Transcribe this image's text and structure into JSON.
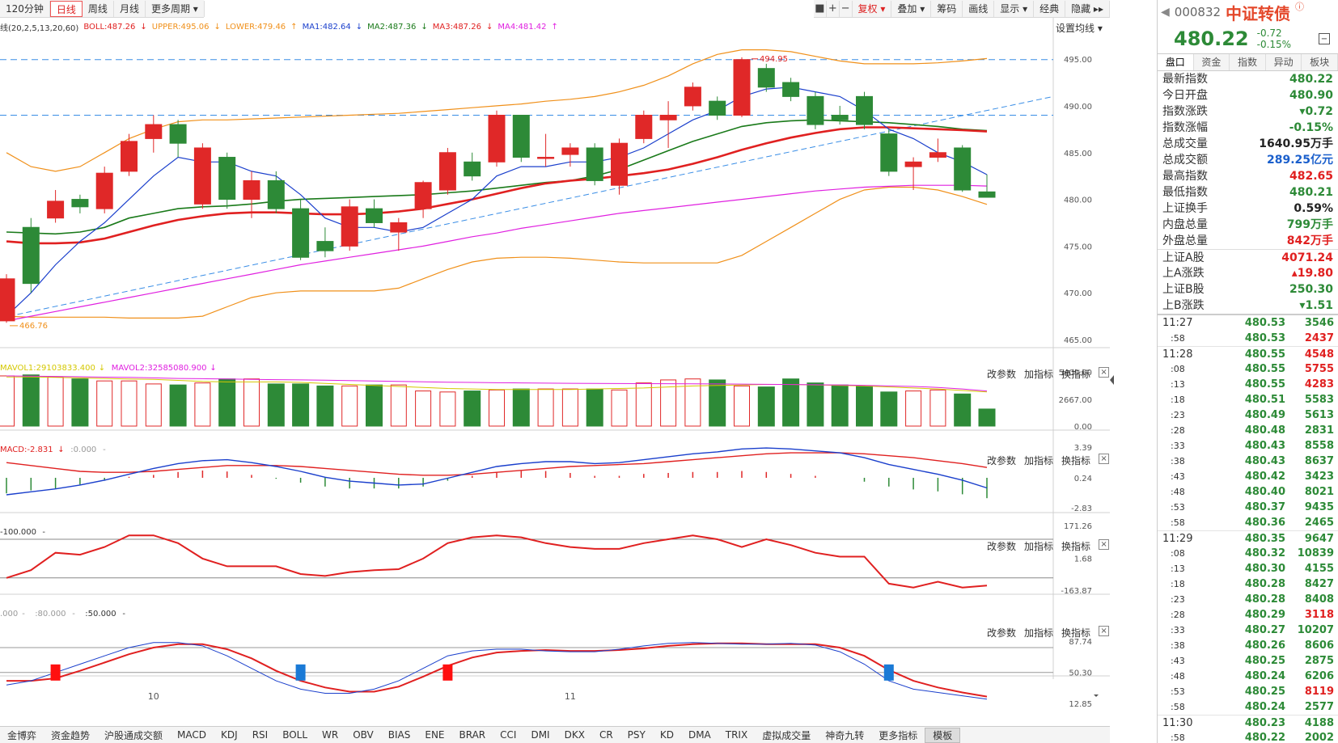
{
  "toolbar": {
    "period_tabs": [
      "120分钟",
      "日线",
      "周线",
      "月线",
      "更多周期 ▾"
    ],
    "active_period": "日线",
    "right_items": [
      "复权 ▾",
      "叠加 ▾",
      "筹码",
      "画线",
      "显示 ▾",
      "经典",
      "隐藏 ▸▸"
    ],
    "icons": [
      "lock-icon",
      "plus-icon",
      "minus-icon"
    ]
  },
  "legend": {
    "prefix": "线(20,2,5,13,20,60)",
    "items": [
      {
        "text": "BOLL:487.26",
        "color": "#e02020",
        "arrow": "↓"
      },
      {
        "text": "UPPER:495.06",
        "color": "#f0901a",
        "arrow": "↓"
      },
      {
        "text": "LOWER:479.46",
        "color": "#f0901a",
        "arrow": "↑"
      },
      {
        "text": "MA1:482.64",
        "color": "#1a3fcc",
        "arrow": "↓"
      },
      {
        "text": "MA2:487.36",
        "color": "#1a7a1a",
        "arrow": "↓"
      },
      {
        "text": "MA3:487.26",
        "color": "#e02020",
        "arrow": "↓"
      },
      {
        "text": "MA4:481.42",
        "color": "#e020e0",
        "arrow": "↑"
      }
    ],
    "setting_label": "设置均线 ▾"
  },
  "price_axis": [
    "495.00",
    "490.00",
    "485.00",
    "480.00",
    "475.00",
    "470.00",
    "465.00"
  ],
  "annotations": {
    "high": "494.95",
    "low": "466.76"
  },
  "vol_legend": [
    {
      "text": "MAVOL1:29103833.400",
      "color": "#d4c800",
      "arrow": "↓"
    },
    {
      "text": "MAVOL2:32585080.900",
      "color": "#e020e0",
      "arrow": "↓"
    }
  ],
  "vol_axis": [
    "5400.00",
    "2667.00",
    "0.00"
  ],
  "macd_legend": [
    {
      "text": "MACD:-2.831",
      "color": "#e02020",
      "arrow": "↓"
    },
    {
      "text": ":0.000",
      "color": "#999999",
      "arrow": "-"
    }
  ],
  "macd_axis": [
    "3.39",
    "0.24",
    "-2.83"
  ],
  "cci_legend": [
    {
      "text": "-100.000",
      "color": "#333333",
      "arrow": "-"
    }
  ],
  "cci_axis": [
    "171.26",
    "1.68",
    "-163.87"
  ],
  "kdj_legend": [
    {
      "text": ".000",
      "color": "#999999",
      "arrow": "-"
    },
    {
      "text": ":80.000",
      "color": "#999999",
      "arrow": "-"
    },
    {
      "text": ":50.000",
      "color": "#333333",
      "arrow": "-"
    }
  ],
  "kdj_axis": [
    "87.74",
    "50.30",
    "12.85"
  ],
  "panel_controls": [
    "改参数",
    "加指标",
    "换指标"
  ],
  "x_labels": [
    "10",
    "11"
  ],
  "bottom_tabs": [
    "金博弈",
    "资金趋势",
    "沪股通成交额",
    "MACD",
    "KDJ",
    "RSI",
    "BOLL",
    "WR",
    "OBV",
    "BIAS",
    "ENE",
    "BRAR",
    "CCI",
    "DMI",
    "DKX",
    "CR",
    "PSY",
    "KD",
    "DMA",
    "TRIX",
    "虚拟成交量",
    "神奇九转",
    "更多指标",
    "模板"
  ],
  "active_bottom": "模板",
  "quote": {
    "code": "000832",
    "name": "中证转债",
    "price": "480.22",
    "change": "-0.72",
    "change_pct": "-0.15%"
  },
  "right_tabs": [
    "盘口",
    "资金",
    "指数",
    "异动",
    "板块"
  ],
  "stats": [
    {
      "k": "最新指数",
      "v": "480.22",
      "c": "#2d8a37"
    },
    {
      "k": "今日开盘",
      "v": "480.90",
      "c": "#2d8a37"
    },
    {
      "k": "指数涨跌",
      "v": "▾0.72",
      "c": "#2d8a37"
    },
    {
      "k": "指数涨幅",
      "v": "-0.15%",
      "c": "#2d8a37"
    },
    {
      "k": "总成交量",
      "v": "1640.95万手",
      "c": "#222222"
    },
    {
      "k": "总成交额",
      "v": "289.25亿元",
      "c": "#1a5fcc"
    },
    {
      "k": "最高指数",
      "v": "482.65",
      "c": "#e02020"
    },
    {
      "k": "最低指数",
      "v": "480.21",
      "c": "#2d8a37"
    },
    {
      "k": "上证换手",
      "v": "0.59%",
      "c": "#222222"
    },
    {
      "k": "内盘总量",
      "v": "799万手",
      "c": "#2d8a37"
    },
    {
      "k": "外盘总量",
      "v": "842万手",
      "c": "#e02020"
    },
    {
      "k": "上证A股",
      "v": "4071.24",
      "c": "#e02020"
    },
    {
      "k": "上A涨跌",
      "v": "▴19.80",
      "c": "#e02020"
    },
    {
      "k": "上证B股",
      "v": "250.30",
      "c": "#2d8a37"
    },
    {
      "k": "上B涨跌",
      "v": "▾1.51",
      "c": "#2d8a37"
    }
  ],
  "ticks": [
    {
      "t": "11:27",
      "p": "480.53",
      "v": "3546",
      "c": "#2d8a37"
    },
    {
      "t": ":58",
      "p": "480.53",
      "v": "2437",
      "c": "#e02020"
    },
    {
      "t": "11:28",
      "p": "480.55",
      "v": "4548",
      "c": "#e02020"
    },
    {
      "t": ":08",
      "p": "480.55",
      "v": "5755",
      "c": "#e02020"
    },
    {
      "t": ":13",
      "p": "480.55",
      "v": "4283",
      "c": "#e02020"
    },
    {
      "t": ":18",
      "p": "480.51",
      "v": "5583",
      "c": "#2d8a37"
    },
    {
      "t": ":23",
      "p": "480.49",
      "v": "5613",
      "c": "#2d8a37"
    },
    {
      "t": ":28",
      "p": "480.48",
      "v": "2831",
      "c": "#2d8a37"
    },
    {
      "t": ":33",
      "p": "480.43",
      "v": "8558",
      "c": "#2d8a37"
    },
    {
      "t": ":38",
      "p": "480.43",
      "v": "8637",
      "c": "#2d8a37"
    },
    {
      "t": ":43",
      "p": "480.42",
      "v": "3423",
      "c": "#2d8a37"
    },
    {
      "t": ":48",
      "p": "480.40",
      "v": "8021",
      "c": "#2d8a37"
    },
    {
      "t": ":53",
      "p": "480.37",
      "v": "9435",
      "c": "#2d8a37"
    },
    {
      "t": ":58",
      "p": "480.36",
      "v": "2465",
      "c": "#2d8a37"
    },
    {
      "t": "11:29",
      "p": "480.35",
      "v": "9647",
      "c": "#2d8a37"
    },
    {
      "t": ":08",
      "p": "480.32",
      "v": "10839",
      "c": "#2d8a37"
    },
    {
      "t": ":13",
      "p": "480.30",
      "v": "4155",
      "c": "#2d8a37"
    },
    {
      "t": ":18",
      "p": "480.28",
      "v": "8427",
      "c": "#2d8a37"
    },
    {
      "t": ":23",
      "p": "480.28",
      "v": "8408",
      "c": "#2d8a37"
    },
    {
      "t": ":28",
      "p": "480.29",
      "v": "3118",
      "c": "#e02020"
    },
    {
      "t": ":33",
      "p": "480.27",
      "v": "10207",
      "c": "#2d8a37"
    },
    {
      "t": ":38",
      "p": "480.26",
      "v": "8606",
      "c": "#2d8a37"
    },
    {
      "t": ":43",
      "p": "480.25",
      "v": "2875",
      "c": "#2d8a37"
    },
    {
      "t": ":48",
      "p": "480.24",
      "v": "6206",
      "c": "#2d8a37"
    },
    {
      "t": ":53",
      "p": "480.25",
      "v": "8119",
      "c": "#e02020"
    },
    {
      "t": ":58",
      "p": "480.24",
      "v": "2577",
      "c": "#2d8a37"
    },
    {
      "t": "11:30",
      "p": "480.23",
      "v": "4188",
      "c": "#2d8a37"
    },
    {
      "t": ":58",
      "p": "480.22",
      "v": "2002",
      "c": "#2d8a37"
    }
  ],
  "chart_data": {
    "type": "candlestick",
    "ylim": [
      465,
      497
    ],
    "candles": [
      [
        467.0,
        471.5,
        466.8,
        472.0
      ],
      [
        477.0,
        471.0,
        470.0,
        478.0
      ],
      [
        478.0,
        479.8,
        477.5,
        481.0
      ],
      [
        480.0,
        479.2,
        478.5,
        480.5
      ],
      [
        479.0,
        482.8,
        478.5,
        483.5
      ],
      [
        483.0,
        486.2,
        482.5,
        487.0
      ],
      [
        486.5,
        488.0,
        485.0,
        489.0
      ],
      [
        488.0,
        486.0,
        484.5,
        488.5
      ],
      [
        479.5,
        485.5,
        479.0,
        486.0
      ],
      [
        484.5,
        480.0,
        479.0,
        485.0
      ],
      [
        480.0,
        482.0,
        478.0,
        483.0
      ],
      [
        482.0,
        479.0,
        478.5,
        483.0
      ],
      [
        479.0,
        473.8,
        473.5,
        480.0
      ],
      [
        475.5,
        474.5,
        473.8,
        477.0
      ],
      [
        475.0,
        479.2,
        474.5,
        480.0
      ],
      [
        479.0,
        477.5,
        477.0,
        480.0
      ],
      [
        476.5,
        477.5,
        474.5,
        478.0
      ],
      [
        479.0,
        481.8,
        478.0,
        482.0
      ],
      [
        481.0,
        485.0,
        480.5,
        485.5
      ],
      [
        484.0,
        482.5,
        482.0,
        485.0
      ],
      [
        484.0,
        489.0,
        483.5,
        489.5
      ],
      [
        489.0,
        484.5,
        484.0,
        489.0
      ],
      [
        484.5,
        484.5,
        483.5,
        487.0
      ],
      [
        484.8,
        485.5,
        483.5,
        486.0
      ],
      [
        485.5,
        482.0,
        481.5,
        486.0
      ],
      [
        481.5,
        486.0,
        480.5,
        486.5
      ],
      [
        486.5,
        489.0,
        486.0,
        489.5
      ],
      [
        488.5,
        489.0,
        485.5,
        490.5
      ],
      [
        490.0,
        492.0,
        489.5,
        492.5
      ],
      [
        490.5,
        489.0,
        488.5,
        491.0
      ],
      [
        489.0,
        494.95,
        488.8,
        495.2
      ],
      [
        494.0,
        492.0,
        491.5,
        494.5
      ],
      [
        492.5,
        491.0,
        490.5,
        493.0
      ],
      [
        491.0,
        488.0,
        487.5,
        491.5
      ],
      [
        489.0,
        488.5,
        488.0,
        490.0
      ],
      [
        491.0,
        488.0,
        487.5,
        491.5
      ],
      [
        487.0,
        483.0,
        482.5,
        487.5
      ],
      [
        483.5,
        484.0,
        481.0,
        484.5
      ],
      [
        484.5,
        485.0,
        484.0,
        486.5
      ],
      [
        485.5,
        481.0,
        480.8,
        485.8
      ],
      [
        480.8,
        480.22,
        480.21,
        482.65
      ]
    ],
    "ma1": [
      467.5,
      470,
      473,
      475.5,
      477.5,
      480,
      482.5,
      484.5,
      484,
      484,
      483,
      482.5,
      480.5,
      478,
      477,
      477,
      476.5,
      477,
      478.5,
      480,
      482.5,
      483.5,
      483.5,
      484,
      484,
      484.5,
      485.5,
      487,
      488.5,
      489.5,
      491,
      491.8,
      492,
      491.5,
      491,
      489.5,
      487.5,
      486.5,
      485,
      484,
      482.64
    ],
    "ma2": [
      476.5,
      476.4,
      476.3,
      476.5,
      477,
      478,
      478.5,
      479,
      479.2,
      479.3,
      479.5,
      479.8,
      480,
      480.1,
      480.2,
      480.3,
      480.4,
      480.5,
      480.7,
      480.9,
      481.2,
      481.5,
      481.8,
      482,
      482.5,
      483.2,
      484.2,
      485.2,
      486.2,
      487,
      487.8,
      488.2,
      488.4,
      488.5,
      488.4,
      488.3,
      488.2,
      488,
      487.8,
      487.5,
      487.36
    ],
    "ma3": [
      475.5,
      475.3,
      475.3,
      475.4,
      475.8,
      476.5,
      477.2,
      477.8,
      478.2,
      478.5,
      478.6,
      478.6,
      478.5,
      478.4,
      478.4,
      478.5,
      478.7,
      479,
      479.5,
      480,
      480.6,
      481.2,
      481.7,
      482,
      482.2,
      482.5,
      482.8,
      483.2,
      483.8,
      484.5,
      485.3,
      486,
      486.6,
      487.1,
      487.5,
      487.7,
      487.7,
      487.6,
      487.5,
      487.4,
      487.26
    ],
    "ma4": [
      467.0,
      467.5,
      468.0,
      468.5,
      469.0,
      469.5,
      470.0,
      470.5,
      471.0,
      471.5,
      472.0,
      472.5,
      473.0,
      473.4,
      473.8,
      474.2,
      474.6,
      475.0,
      475.5,
      476.0,
      476.4,
      476.9,
      477.3,
      477.7,
      478.1,
      478.5,
      478.8,
      479.1,
      479.4,
      479.7,
      480.0,
      480.3,
      480.6,
      480.9,
      481.1,
      481.3,
      481.4,
      481.5,
      481.5,
      481.5,
      481.42
    ],
    "upper": [
      485,
      483.5,
      483,
      483.5,
      485,
      486.5,
      487.5,
      488.3,
      488.5,
      488.5,
      488.6,
      488.7,
      488.8,
      488.9,
      489,
      489.1,
      489.2,
      489.4,
      489.6,
      489.8,
      490,
      490.2,
      490.5,
      490.7,
      491,
      491.5,
      492.2,
      493.2,
      494.5,
      495.5,
      496,
      496,
      495.8,
      495.3,
      494.8,
      494.5,
      494.5,
      494.5,
      494.6,
      494.8,
      495.06
    ],
    "lower": [
      467.5,
      467.4,
      467.4,
      467.4,
      467.4,
      467.3,
      467.3,
      467.3,
      467.5,
      468.5,
      469.5,
      470.0,
      470.2,
      470.2,
      470.2,
      470.2,
      470.5,
      471.5,
      472.5,
      473.3,
      473.7,
      473.8,
      473.8,
      473.7,
      473.5,
      473.3,
      473.2,
      473.2,
      473.2,
      473.2,
      474.0,
      475.5,
      477.0,
      478.5,
      480.0,
      481.0,
      481.3,
      481.3,
      481.0,
      480.3,
      479.46
    ],
    "volume": [
      5000,
      5100,
      4900,
      4700,
      4500,
      4500,
      4200,
      4100,
      4300,
      4700,
      4700,
      4200,
      4200,
      4000,
      4000,
      4100,
      4100,
      3500,
      3400,
      3500,
      3600,
      3700,
      3700,
      3700,
      3700,
      3600,
      4300,
      4600,
      4700,
      4600,
      4000,
      3900,
      4700,
      4300,
      4100,
      4000,
      3400,
      3500,
      3600,
      3200,
      1700
    ],
    "mavol1": [
      4900,
      4900,
      4850,
      4800,
      4750,
      4700,
      4650,
      4550,
      4450,
      4400,
      4400,
      4400,
      4350,
      4250,
      4150,
      4050,
      3950,
      3850,
      3750,
      3700,
      3650,
      3650,
      3650,
      3650,
      3700,
      3750,
      3800,
      3900,
      4000,
      4050,
      4100,
      4150,
      4150,
      4100,
      4050,
      4000,
      3900,
      3800,
      3700,
      3550,
      3400
    ],
    "mavol2": [
      5000,
      4980,
      4950,
      4920,
      4880,
      4850,
      4800,
      4750,
      4720,
      4690,
      4660,
      4630,
      4600,
      4570,
      4540,
      4500,
      4460,
      4420,
      4380,
      4350,
      4320,
      4300,
      4280,
      4260,
      4250,
      4240,
      4230,
      4220,
      4210,
      4200,
      4180,
      4160,
      4140,
      4120,
      4100,
      4060,
      4000,
      3950,
      3850,
      3700,
      3500
    ],
    "macd_dif": [
      -1.5,
      -1.2,
      -0.9,
      -0.5,
      0.0,
      0.6,
      1.2,
      1.7,
      2.0,
      2.1,
      1.8,
      1.4,
      0.9,
      0.3,
      -0.1,
      -0.3,
      -0.5,
      -0.4,
      0.2,
      0.8,
      1.4,
      1.7,
      1.9,
      1.9,
      1.7,
      1.8,
      2.1,
      2.4,
      2.7,
      2.9,
      3.2,
      3.3,
      3.2,
      3.0,
      2.8,
      2.3,
      1.6,
      1.1,
      0.6,
      0.0,
      -0.8
    ],
    "macd_dea": [
      1.8,
      1.5,
      1.2,
      0.9,
      0.8,
      0.8,
      0.9,
      1.1,
      1.3,
      1.5,
      1.5,
      1.5,
      1.4,
      1.2,
      1.0,
      0.8,
      0.6,
      0.5,
      0.5,
      0.6,
      0.8,
      1.0,
      1.2,
      1.4,
      1.5,
      1.6,
      1.7,
      1.9,
      2.1,
      2.3,
      2.5,
      2.7,
      2.8,
      2.8,
      2.8,
      2.7,
      2.5,
      2.3,
      2.0,
      1.7,
      1.3
    ],
    "macd_bar": [
      -3.2,
      -2.6,
      -2.2,
      -1.4,
      -0.6,
      0.2,
      0.6,
      1.2,
      1.5,
      1.3,
      0.6,
      -0.2,
      -1.0,
      -1.8,
      -2.2,
      -2.2,
      -2.2,
      -1.8,
      -0.6,
      0.4,
      1.2,
      1.4,
      1.4,
      1.0,
      0.4,
      0.4,
      0.8,
      1.0,
      1.2,
      1.2,
      1.4,
      1.2,
      0.8,
      0.4,
      0.0,
      -0.8,
      -1.8,
      -2.4,
      -2.8,
      -3.4,
      -4.2
    ],
    "cci": [
      -100,
      -60,
      30,
      20,
      60,
      120,
      120,
      80,
      0,
      -40,
      -40,
      -40,
      -80,
      -90,
      -70,
      -60,
      -55,
      0,
      80,
      110,
      120,
      110,
      80,
      60,
      50,
      50,
      80,
      100,
      120,
      100,
      60,
      100,
      70,
      30,
      10,
      10,
      -130,
      -150,
      -120,
      -150,
      -140
    ],
    "kdj_k": [
      35,
      40,
      50,
      60,
      70,
      80,
      86,
      86,
      82,
      70,
      55,
      40,
      30,
      25,
      25,
      30,
      40,
      55,
      70,
      76,
      78,
      78,
      76,
      75,
      75,
      78,
      82,
      85,
      86,
      85,
      84,
      84,
      85,
      83,
      75,
      60,
      40,
      30,
      26,
      22,
      18
    ],
    "kdj_d": [
      40,
      40,
      43,
      52,
      62,
      72,
      80,
      84,
      84,
      78,
      67,
      52,
      40,
      32,
      27,
      27,
      33,
      45,
      58,
      68,
      74,
      76,
      77,
      76,
      76,
      77,
      79,
      82,
      84,
      85,
      85,
      84,
      84,
      84,
      80,
      70,
      53,
      40,
      32,
      26,
      21
    ],
    "kdj_marks": [
      {
        "i": 2,
        "type": "buy"
      },
      {
        "i": 12,
        "type": "sell"
      },
      {
        "i": 18,
        "type": "buy"
      },
      {
        "i": 36,
        "type": "sell"
      }
    ]
  }
}
